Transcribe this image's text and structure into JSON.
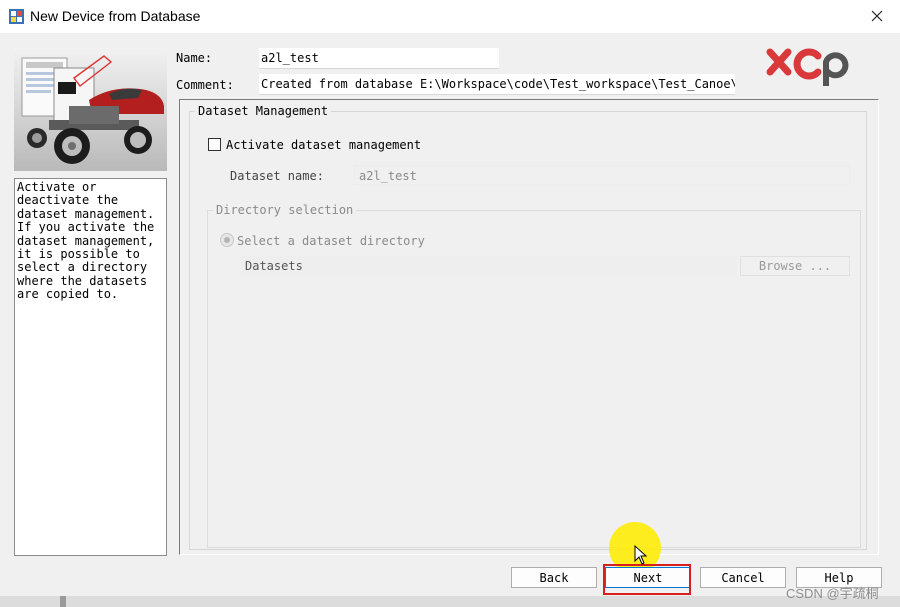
{
  "window": {
    "title": "New Device from Database"
  },
  "header": {
    "name_label": "Name:",
    "name_value": "a2l_test",
    "comment_label": "Comment:",
    "comment_value": "Created from database E:\\Workspace\\code\\Test_workspace\\Test_Canoe\\P"
  },
  "help_text": "Activate or\ndeactivate the\ndataset management.\nIf you activate the\ndataset management,\nit is possible to\nselect a directory\nwhere the datasets\nare copied to.",
  "dataset_management": {
    "group_title": "Dataset Management",
    "activate_label": "Activate dataset management",
    "activate_checked": false,
    "dataset_name_label": "Dataset name:",
    "dataset_name_value": "a2l_test",
    "directory_group_title": "Directory selection",
    "select_dir_label": "Select a dataset directory",
    "datasets_label": "Datasets",
    "browse_label": "Browse ..."
  },
  "buttons": {
    "back": "Back",
    "next": "Next",
    "cancel": "Cancel",
    "help": "Help"
  },
  "watermark": "CSDN @宇疏桐",
  "colors": {
    "highlight": "#d62020",
    "cursor_halo": "#ffec00",
    "focus_border": "#0078d7",
    "logo_red": "#d9393b",
    "logo_gray": "#555555"
  }
}
